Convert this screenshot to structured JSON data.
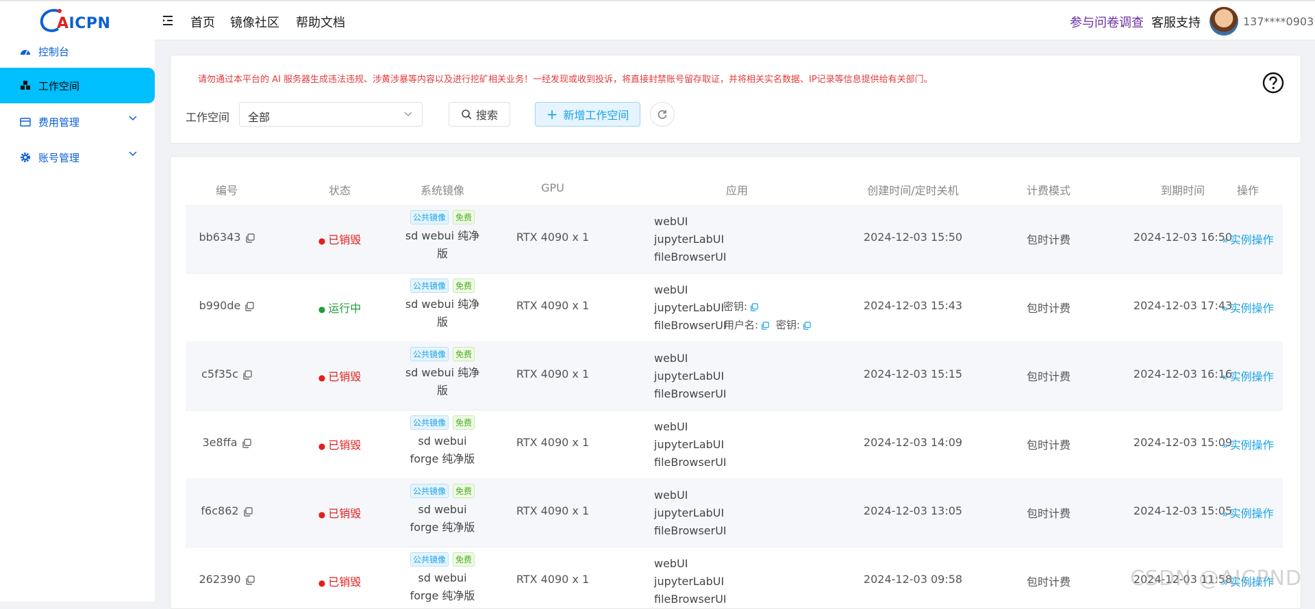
{
  "brand": {
    "logo": "AICPN"
  },
  "sidebar": {
    "items": [
      {
        "label": "控制台",
        "icon": "dashboard-icon"
      },
      {
        "label": "工作空间",
        "icon": "workspace-icon",
        "active": true
      },
      {
        "label": "费用管理",
        "icon": "billing-icon",
        "expandable": true
      },
      {
        "label": "账号管理",
        "icon": "gear-icon",
        "expandable": true
      }
    ]
  },
  "header": {
    "nav": [
      "首页",
      "镜像社区",
      "帮助文档"
    ],
    "survey": "参与问卷调查",
    "support": "客服支持",
    "user": "137****0903"
  },
  "filter": {
    "notice": "请勿通过本平台的 AI 服务器生成违法违规、涉黄涉暴等内容以及进行挖矿相关业务！一经发现或收到投诉，将直接封禁账号留存取证，并将相关实名数据、IP记录等信息提供给有关部门。",
    "workspace_label": "工作空间",
    "workspace_value": "全部",
    "search_label": "搜索",
    "add_label": "新增工作空间"
  },
  "table": {
    "headers": [
      "编号",
      "状态",
      "系统镜像",
      "GPU",
      "应用",
      "创建时间/定时关机",
      "计费模式",
      "到期时间",
      "操作"
    ],
    "tag_public": "公共镜像",
    "tag_free": "免费",
    "cred_key": "密钥:",
    "cred_user": "用户名:",
    "rows": [
      {
        "id": "bb6343",
        "status": "已销毁",
        "status_color": "#e0201e",
        "image": [
          "sd webui 纯净",
          "版"
        ],
        "gpu": "RTX 4090 x 1",
        "apps": [
          "webUI",
          "jupyterLabUI",
          "fileBrowserUI"
        ],
        "created": "2024-12-03 15:50",
        "billing": "包时计费",
        "expire": "2024-12-03 16:50",
        "op": "实例操作"
      },
      {
        "id": "b990de",
        "status": "运行中",
        "status_color": "#1f9d3a",
        "image": [
          "sd webui 纯净",
          "版"
        ],
        "gpu": "RTX 4090 x 1",
        "apps": [
          "webUI",
          "jupyterLabUI",
          "fileBrowserUI"
        ],
        "created": "2024-12-03 15:43",
        "billing": "包时计费",
        "expire": "2024-12-03 17:43",
        "op": "实例操作"
      },
      {
        "id": "c5f35c",
        "status": "已销毁",
        "status_color": "#e0201e",
        "image": [
          "sd webui 纯净",
          "版"
        ],
        "gpu": "RTX 4090 x 1",
        "apps": [
          "webUI",
          "jupyterLabUI",
          "fileBrowserUI"
        ],
        "created": "2024-12-03 15:15",
        "billing": "包时计费",
        "expire": "2024-12-03 16:16",
        "op": "实例操作"
      },
      {
        "id": "3e8ffa",
        "status": "已销毁",
        "status_color": "#e0201e",
        "image": [
          "sd webui",
          "forge 纯净版"
        ],
        "gpu": "RTX 4090 x 1",
        "apps": [
          "webUI",
          "jupyterLabUI",
          "fileBrowserUI"
        ],
        "created": "2024-12-03 14:09",
        "billing": "包时计费",
        "expire": "2024-12-03 15:09",
        "op": "实例操作"
      },
      {
        "id": "f6c862",
        "status": "已销毁",
        "status_color": "#e0201e",
        "image": [
          "sd webui",
          "forge 纯净版"
        ],
        "gpu": "RTX 4090 x 1",
        "apps": [
          "webUI",
          "jupyterLabUI",
          "fileBrowserUI"
        ],
        "created": "2024-12-03 13:05",
        "billing": "包时计费",
        "expire": "2024-12-03 15:05",
        "op": "实例操作"
      },
      {
        "id": "262390",
        "status": "已销毁",
        "status_color": "#e0201e",
        "image": [
          "sd webui",
          "forge 纯净版"
        ],
        "gpu": "RTX 4090 x 1",
        "apps": [
          "webUI",
          "jupyterLabUI",
          "fileBrowserUI"
        ],
        "created": "2024-12-03 09:58",
        "billing": "包时计费",
        "expire": "2024-12-03 11:58",
        "op": "实例操作"
      }
    ]
  },
  "watermark": "CSDN @AICPND"
}
